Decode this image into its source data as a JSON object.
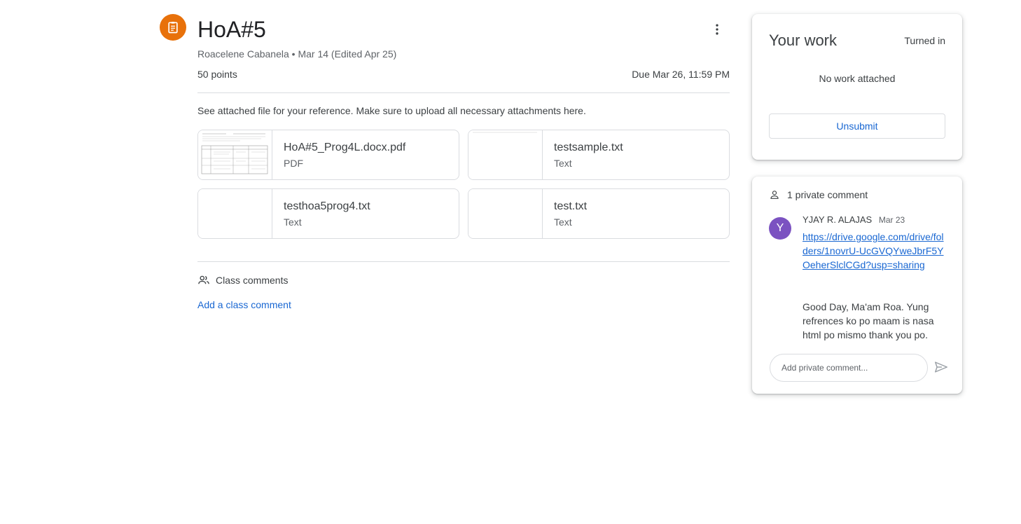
{
  "assignment": {
    "title": "HoA#5",
    "meta": "Roacelene Cabanela • Mar 14 (Edited Apr 25)",
    "points": "50 points",
    "due": "Due Mar 26, 11:59 PM",
    "instructions": "See attached file for your reference. Make sure to upload all necessary attachments here.",
    "attachments": [
      {
        "name": "HoA#5_Prog4L.docx.pdf",
        "type": "PDF"
      },
      {
        "name": "testsample.txt",
        "type": "Text"
      },
      {
        "name": "testhoa5prog4.txt",
        "type": "Text"
      },
      {
        "name": "test.txt",
        "type": "Text"
      }
    ]
  },
  "class_comments": {
    "label": "Class comments",
    "add_label": "Add a class comment"
  },
  "your_work": {
    "title": "Your work",
    "status": "Turned in",
    "empty_text": "No work attached",
    "unsubmit_label": "Unsubmit"
  },
  "private_comments": {
    "header": "1 private comment",
    "comment": {
      "avatar_letter": "Y",
      "author": "YJAY R. ALAJAS",
      "date": "Mar 23",
      "link": "https://drive.google.com/drive/folders/1novrU-UcGVQYweJbrF5YOeherSlclCGd?usp=sharing",
      "text": "Good Day, Ma'am Roa. Yung refrences ko po maam is nasa html po mismo thank you po."
    },
    "input_placeholder": "Add private comment..."
  },
  "colors": {
    "accent_orange": "#e8710a",
    "link_blue": "#1967d2",
    "avatar_purple": "#7b52c1"
  },
  "icons": {
    "assignment": "assignment-clipboard-icon",
    "more": "more-vert-icon",
    "class_comments": "people-icon",
    "private_comments": "person-icon",
    "send": "send-icon"
  }
}
